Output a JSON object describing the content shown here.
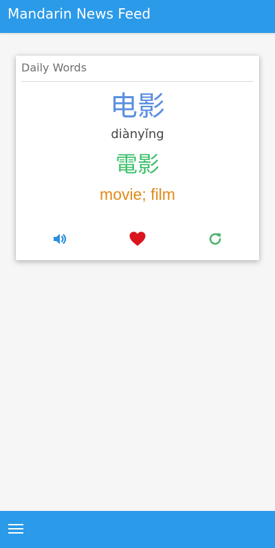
{
  "header": {
    "title": "Mandarin News Feed"
  },
  "card": {
    "title": "Daily Words",
    "word": {
      "simplified": "电影",
      "pinyin": "diànyǐng",
      "traditional": "電影",
      "meaning": "movie; film"
    },
    "actions": [
      {
        "icon": "speaker-icon",
        "color": "#2b8fd9"
      },
      {
        "icon": "heart-icon",
        "color": "#d9141c"
      },
      {
        "icon": "refresh-icon",
        "color": "#4cb26e"
      }
    ]
  },
  "colors": {
    "primary": "#2b9ae9",
    "simplified": "#5b8fe0",
    "traditional": "#3fc06c",
    "meaning": "#e2891a",
    "background": "#f6f6f6"
  },
  "bottom_bar": {
    "icon": "hamburger-menu-icon"
  }
}
